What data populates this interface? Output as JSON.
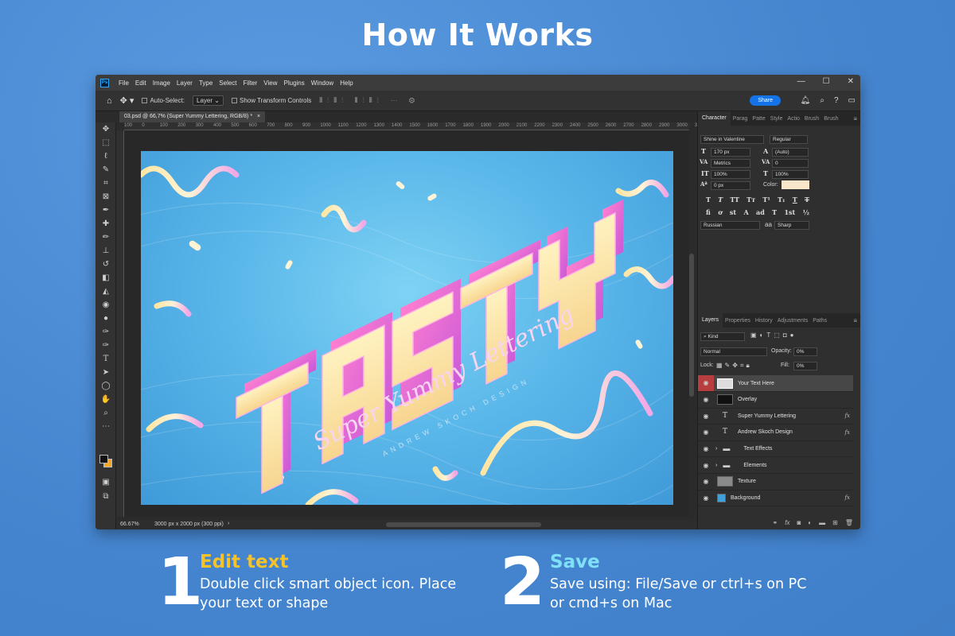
{
  "headline": "How It Works",
  "menubar": {
    "logo": "Ps",
    "items": [
      "File",
      "Edit",
      "Image",
      "Layer",
      "Type",
      "Select",
      "Filter",
      "View",
      "Plugins",
      "Window",
      "Help"
    ]
  },
  "options": {
    "auto_select_label": "Auto-Select:",
    "auto_select_value": "Layer",
    "transform_label": "Show Transform Controls",
    "share_label": "Share"
  },
  "document": {
    "tab_title": "03.psd @ 66,7% (Super Yummy Lettering, RGB/8) *",
    "zoom": "66.67%",
    "doc_size": "3000 px x 2000 px (300 ppi)"
  },
  "ruler_numbers": [
    "100",
    "0",
    "100",
    "200",
    "300",
    "400",
    "500",
    "600",
    "700",
    "800",
    "900",
    "1000",
    "1100",
    "1200",
    "1300",
    "1400",
    "1500",
    "1600",
    "1700",
    "1800",
    "1900",
    "2000",
    "2100",
    "2200",
    "2300",
    "2400",
    "2500",
    "2600",
    "2700",
    "2800",
    "2900",
    "3000",
    "3100"
  ],
  "artwork": {
    "main_text": "TASTY",
    "script_text": "Super Yummy Lettering",
    "small_text": "ANDREW SKOCH DESIGN"
  },
  "character_panel": {
    "tabs": [
      "Character",
      "Parag",
      "Patte",
      "Style",
      "Actio",
      "Brush",
      "Brush"
    ],
    "font_family": "Shine in Valentine",
    "font_style": "Regular",
    "font_size": "170 px",
    "leading": "(Auto)",
    "kerning": "Metrics",
    "tracking": "0",
    "vertical_scale": "100%",
    "horizontal_scale": "100%",
    "baseline_shift": "0 px",
    "color_label": "Color:",
    "language": "Russian",
    "antialias_label": "aa",
    "antialias": "Sharp",
    "type_glyphs": [
      "T",
      "T",
      "TT",
      "Tт",
      "T¹",
      "T₁",
      "T",
      "T"
    ],
    "opentype_glyphs": [
      "fi",
      "ơ",
      "st",
      "A",
      "ad",
      "T",
      "1st",
      "½"
    ]
  },
  "layers_panel": {
    "tabs": [
      "Layers",
      "Properties",
      "History",
      "Adjustments",
      "Paths"
    ],
    "filter_kind": "Kind",
    "blend_mode": "Normal",
    "opacity_label": "Opacity:",
    "opacity": "0%",
    "lock_label": "Lock:",
    "fill_label": "Fill:",
    "fill": "0%",
    "layers": [
      {
        "name": "Your Text Here",
        "kind": "smart",
        "fx": ""
      },
      {
        "name": "Overlay",
        "kind": "image",
        "fx": ""
      },
      {
        "name": "Super Yummy Lettering",
        "kind": "text",
        "fx": "fx"
      },
      {
        "name": "Andrew  Skoch  Design",
        "kind": "text",
        "fx": "fx"
      },
      {
        "name": "Text Effects",
        "kind": "group",
        "fx": ""
      },
      {
        "name": "Elements",
        "kind": "group",
        "fx": ""
      },
      {
        "name": "Texture",
        "kind": "gray",
        "fx": ""
      },
      {
        "name": "Background",
        "kind": "fill",
        "fx": "fx"
      }
    ]
  },
  "steps": [
    {
      "number": "1",
      "title": "Edit text",
      "line1": "Double click smart object icon. Place",
      "line2": "your text or shape",
      "title_color": "#f5c22a"
    },
    {
      "number": "2",
      "title": "Save",
      "line1": "Save using: File/Save or ctrl+s on PC",
      "line2": "or cmd+s on Mac",
      "title_color": "#7fe0f7"
    }
  ],
  "colors": {
    "background": "#4f8fd6",
    "accent": "#1473e6",
    "text_color_swatch": "#f7e6c9"
  }
}
